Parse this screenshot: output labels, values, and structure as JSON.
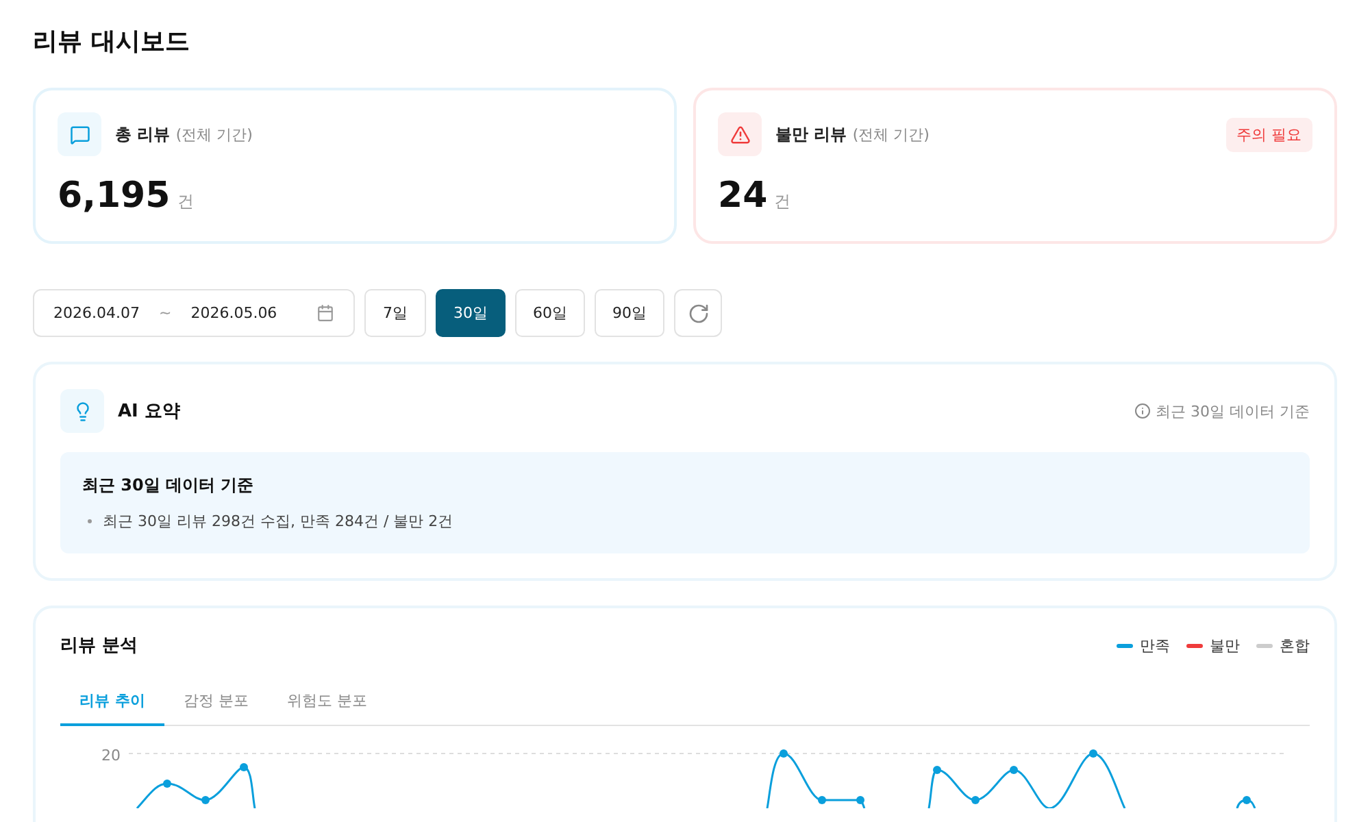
{
  "title": "리뷰 대시보드",
  "stat_cards": [
    {
      "kind": "total",
      "label": "총 리뷰",
      "sub": "(전체 기간)",
      "value": "6,195",
      "unit": "건"
    },
    {
      "kind": "complaint",
      "label": "불만 리뷰",
      "sub": "(전체 기간)",
      "value": "24",
      "unit": "건",
      "badge": "주의 필요"
    }
  ],
  "date_range": {
    "start": "2026.04.07",
    "separator": "~",
    "end": "2026.05.06"
  },
  "period_buttons": [
    {
      "label": "7일",
      "selected": false
    },
    {
      "label": "30일",
      "selected": true
    },
    {
      "label": "60일",
      "selected": false
    },
    {
      "label": "90일",
      "selected": false
    }
  ],
  "ai_summary": {
    "title": "AI 요약",
    "note": "최근 30일 데이터 기준",
    "box_title": "최근 30일 데이터 기준",
    "bullets": [
      "최근 30일 리뷰 298건 수집, 만족 284건 / 불만 2건"
    ]
  },
  "analysis": {
    "title": "리뷰 분석",
    "legend": [
      {
        "label": "만족",
        "color": "#0a9fdc"
      },
      {
        "label": "불만",
        "color": "#ef3b3b"
      },
      {
        "label": "혼합",
        "color": "#cccccc"
      }
    ],
    "tabs": [
      {
        "label": "리뷰 추이",
        "selected": true
      },
      {
        "label": "감정 분포",
        "selected": false
      },
      {
        "label": "위험도 분포",
        "selected": false
      }
    ],
    "y_tick": "20"
  }
}
